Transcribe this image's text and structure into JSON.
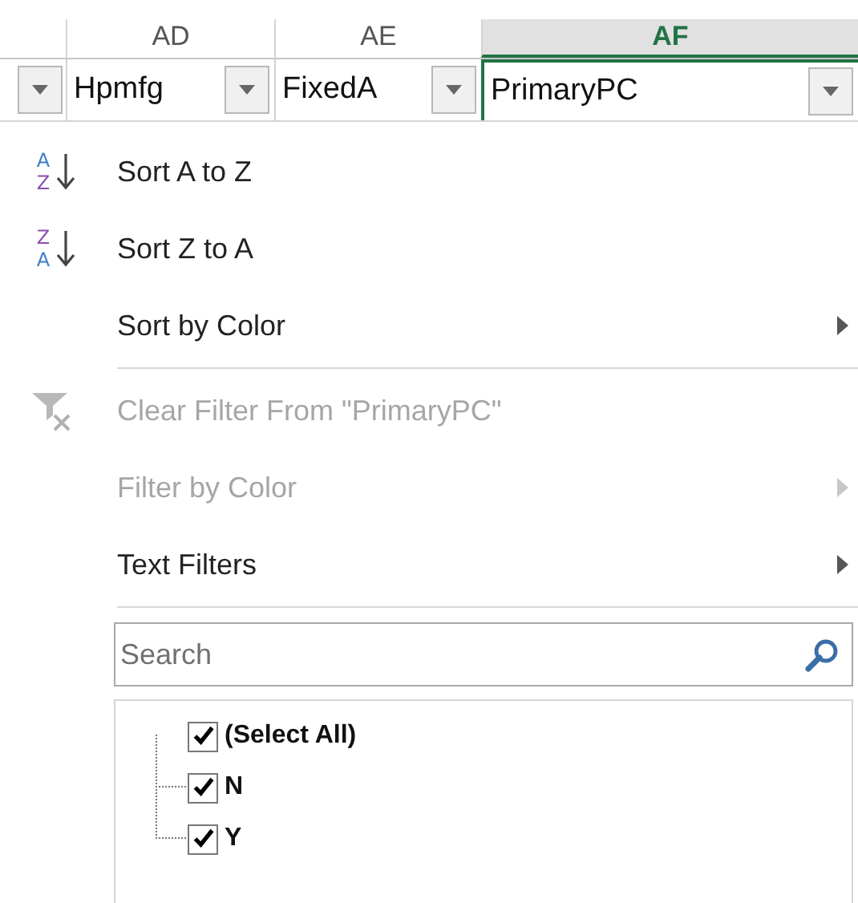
{
  "column_headers": [
    {
      "label": "AD",
      "selected": false
    },
    {
      "label": "AE",
      "selected": false
    },
    {
      "label": "AF",
      "selected": true
    }
  ],
  "header_row": [
    {
      "value": "Hpmfg"
    },
    {
      "value": "FixedA"
    },
    {
      "value": "PrimaryPC"
    }
  ],
  "menu": [
    {
      "kind": "sort_asc",
      "icon_text": [
        "A",
        "Z"
      ],
      "label": "Sort A to Z",
      "disabled": false,
      "submenu": false
    },
    {
      "kind": "sort_desc",
      "icon_text": [
        "Z",
        "A"
      ],
      "label": "Sort Z to A",
      "disabled": false,
      "submenu": false
    },
    {
      "kind": "plain",
      "label": "Sort by Color",
      "disabled": false,
      "submenu": true
    },
    {
      "kind": "separator"
    },
    {
      "kind": "clear_filter",
      "label": "Clear Filter From \"PrimaryPC\"",
      "disabled": true,
      "submenu": false
    },
    {
      "kind": "plain",
      "label": "Filter by Color",
      "disabled": true,
      "submenu": true
    },
    {
      "kind": "plain",
      "label": "Text Filters",
      "disabled": false,
      "submenu": true
    },
    {
      "kind": "separator"
    }
  ],
  "search": {
    "placeholder": "Search"
  },
  "values_tree": [
    {
      "label": "(Select All)",
      "checked": true,
      "children": [
        {
          "label": "N",
          "checked": true
        },
        {
          "label": "Y",
          "checked": true
        }
      ]
    }
  ]
}
